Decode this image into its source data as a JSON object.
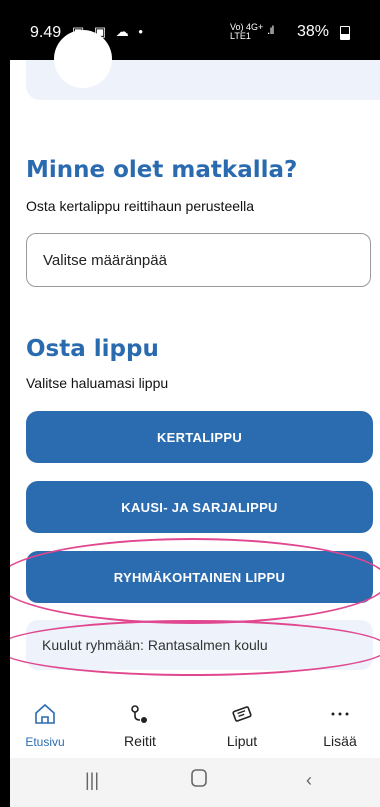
{
  "status_bar": {
    "time": "9.49",
    "network": "Vo) 4G+\nLTE1",
    "signal": ".ıl",
    "battery": "38%"
  },
  "destination_section": {
    "title": "Minne olet matkalla?",
    "subtitle": "Osta kertalippu reittihaun perusteella",
    "input_value": "Valitse määränpää"
  },
  "ticket_section": {
    "title": "Osta lippu",
    "subtitle": "Valitse haluamasi lippu",
    "buttons": [
      "KERTALIPPU",
      "KAUSI- JA SARJALIPPU",
      "RYHMÄKOHTAINEN LIPPU"
    ]
  },
  "group_info": "Kuulut ryhmään: Rantasalmen koulu",
  "bottom_nav": [
    {
      "label": "Etusivu",
      "icon": "home-icon",
      "active": true
    },
    {
      "label": "Reitit",
      "icon": "route-icon"
    },
    {
      "label": "Liput",
      "icon": "ticket-icon"
    },
    {
      "label": "Lisää",
      "icon": "more-icon"
    }
  ],
  "colors": {
    "accent": "#2b6cb0",
    "annotation": "#e0478f"
  }
}
